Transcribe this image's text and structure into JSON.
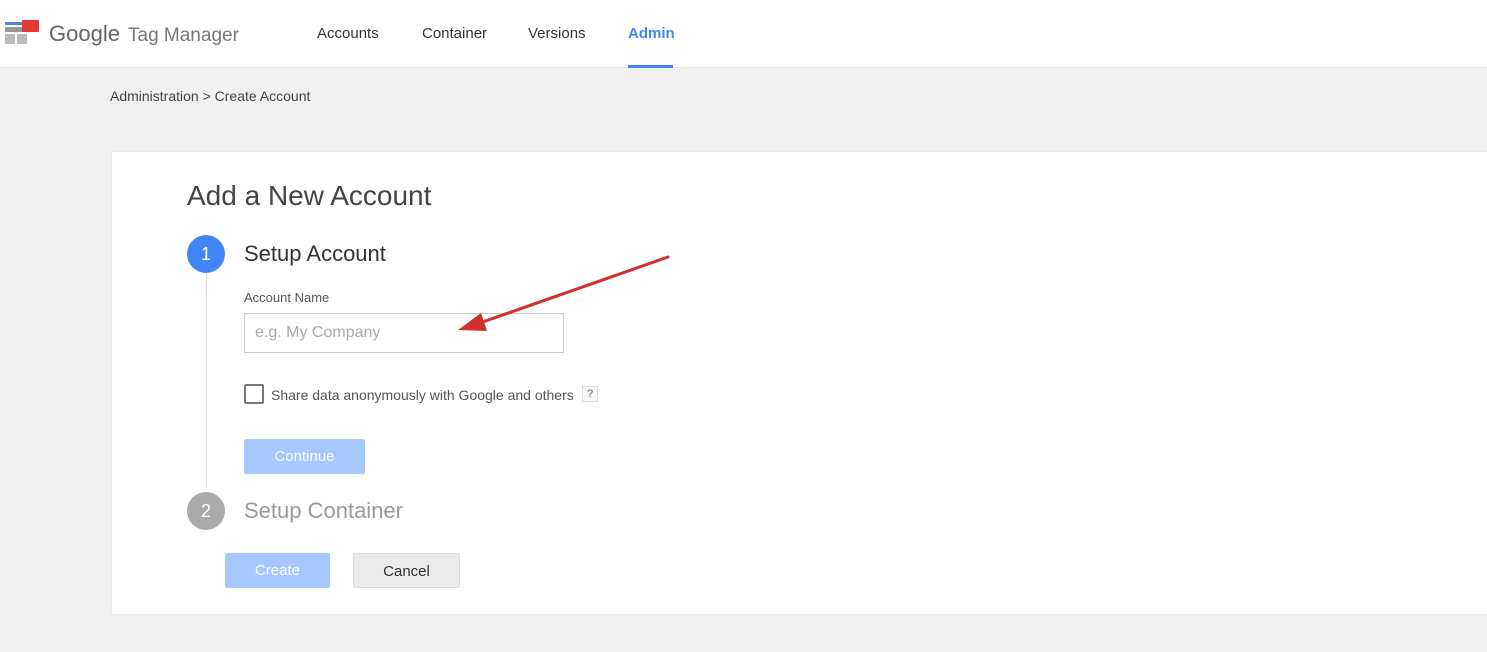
{
  "app": {
    "brand": "Google",
    "product": "Tag Manager",
    "logo_icon": "tag-manager-logo-icon"
  },
  "nav": {
    "items": [
      {
        "label": "Accounts",
        "active": false
      },
      {
        "label": "Container",
        "active": false
      },
      {
        "label": "Versions",
        "active": false
      },
      {
        "label": "Admin",
        "active": true
      }
    ]
  },
  "breadcrumb": "Administration > Create Account",
  "form": {
    "title": "Add a New Account",
    "step1": {
      "number": "1",
      "title": "Setup Account",
      "field_label": "Account Name",
      "placeholder": "e.g. My Company",
      "value": "",
      "checkbox_label": "Share data anonymously with Google and others",
      "checkbox_checked": false,
      "help": "?",
      "continue_label": "Continue"
    },
    "step2": {
      "number": "2",
      "title": "Setup Container"
    },
    "create_label": "Create",
    "cancel_label": "Cancel"
  },
  "colors": {
    "accent": "#4285f4",
    "button_disabled": "#a6c8ff",
    "arrow": "#d32f2f",
    "step_inactive": "#aaaaaa"
  }
}
